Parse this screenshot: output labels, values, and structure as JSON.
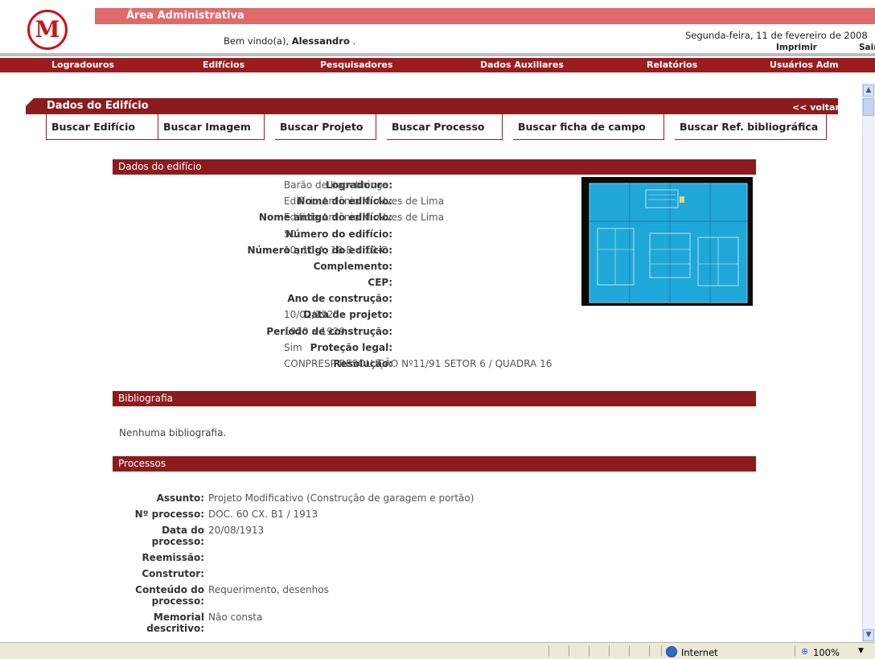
{
  "header": {
    "area_title": "Área Administrativa",
    "welcome_prefix": "Bem vindo(a), ",
    "user_name": "Alessandro",
    "welcome_suffix": " .",
    "date": "Segunda-feira, 11 de fevereiro de 2008",
    "print_label": "Imprimir",
    "logout_label": "Sair"
  },
  "nav": [
    "Logradouros",
    "Edifícios",
    "Pesquisadores",
    "Dados Auxiliares",
    "Relatórios",
    "Usuários Adm"
  ],
  "section": {
    "title": "Dados do Edifício",
    "back_label": "<< voltar"
  },
  "tabs": [
    "Buscar Edifício",
    "Buscar Imagem",
    "Buscar Projeto",
    "Buscar Processo",
    "Buscar ficha de campo",
    "Buscar Ref. bibliográfica"
  ],
  "building": {
    "header": "Dados do edifício",
    "fields": [
      {
        "label": "Logradouro:",
        "value": "Barão de Itapetininga"
      },
      {
        "label": "Nome do edifício:",
        "value": "Edifício Antônio M. Alves de Lima"
      },
      {
        "label": "Nome antigo do edifício:",
        "value": "Edifício Antônio M. Alves de Lima"
      },
      {
        "label": "Número do edifício:",
        "value": "50"
      },
      {
        "label": "Número antigo do edifício:",
        "value": "10, 10-A, 10-B e 10-C"
      },
      {
        "label": "Complemento:",
        "value": ""
      },
      {
        "label": "CEP:",
        "value": ""
      },
      {
        "label": "Ano de construção:",
        "value": ""
      },
      {
        "label": "Data de projeto:",
        "value": "10/02/1925"
      },
      {
        "label": "Período de construção:",
        "value": "1920 a 1929"
      },
      {
        "label": "Proteção legal:",
        "value": "Sim"
      },
      {
        "label": "Resolução:",
        "value": "CONPRESP RESOLUÇÃO Nº11/91 SETOR 6 / QUADRA 16"
      }
    ]
  },
  "bibliography": {
    "header": "Bibliografia",
    "empty_text": "Nenhuma bibliografia."
  },
  "processes": {
    "header": "Processos",
    "fields": [
      {
        "label": "Assunto:",
        "value": "Projeto Modificativo (Construção de garagem e portão)"
      },
      {
        "label": "Nº processo:",
        "value": "DOC. 60 CX. B1 / 1913"
      },
      {
        "label": "Data do processo:",
        "value": "20/08/1913"
      },
      {
        "label": "Reemissão:",
        "value": ""
      },
      {
        "label": "Construtor:",
        "value": ""
      },
      {
        "label": "Conteúdo do processo:",
        "value": "Requerimento, desenhos"
      },
      {
        "label": "Memorial descritivo:",
        "value": "Não consta"
      }
    ]
  },
  "statusbar": {
    "zone": "Internet",
    "zoom": "100%"
  },
  "colors": {
    "brand_red": "#9a1c1f",
    "header_pink": "#e06969",
    "panel_red": "#8c1b1e"
  }
}
